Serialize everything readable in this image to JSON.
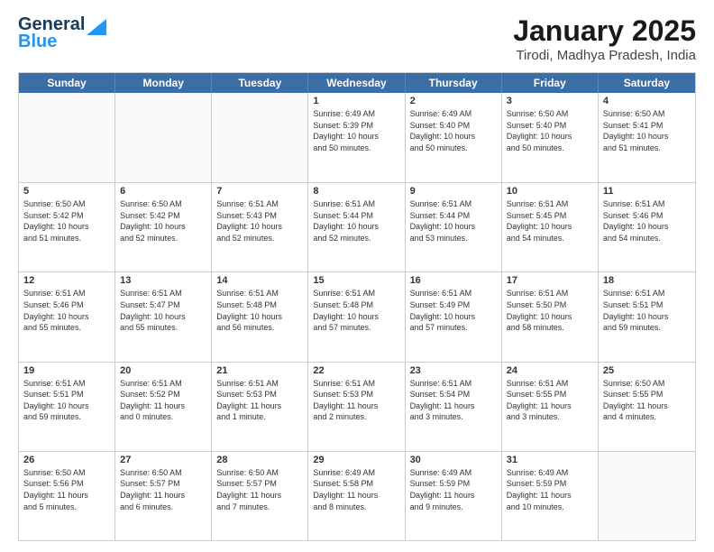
{
  "logo": {
    "line1": "General",
    "line2": "Blue"
  },
  "title": "January 2025",
  "subtitle": "Tirodi, Madhya Pradesh, India",
  "weekdays": [
    "Sunday",
    "Monday",
    "Tuesday",
    "Wednesday",
    "Thursday",
    "Friday",
    "Saturday"
  ],
  "weeks": [
    [
      {
        "day": "",
        "info": ""
      },
      {
        "day": "",
        "info": ""
      },
      {
        "day": "",
        "info": ""
      },
      {
        "day": "1",
        "info": "Sunrise: 6:49 AM\nSunset: 5:39 PM\nDaylight: 10 hours\nand 50 minutes."
      },
      {
        "day": "2",
        "info": "Sunrise: 6:49 AM\nSunset: 5:40 PM\nDaylight: 10 hours\nand 50 minutes."
      },
      {
        "day": "3",
        "info": "Sunrise: 6:50 AM\nSunset: 5:40 PM\nDaylight: 10 hours\nand 50 minutes."
      },
      {
        "day": "4",
        "info": "Sunrise: 6:50 AM\nSunset: 5:41 PM\nDaylight: 10 hours\nand 51 minutes."
      }
    ],
    [
      {
        "day": "5",
        "info": "Sunrise: 6:50 AM\nSunset: 5:42 PM\nDaylight: 10 hours\nand 51 minutes."
      },
      {
        "day": "6",
        "info": "Sunrise: 6:50 AM\nSunset: 5:42 PM\nDaylight: 10 hours\nand 52 minutes."
      },
      {
        "day": "7",
        "info": "Sunrise: 6:51 AM\nSunset: 5:43 PM\nDaylight: 10 hours\nand 52 minutes."
      },
      {
        "day": "8",
        "info": "Sunrise: 6:51 AM\nSunset: 5:44 PM\nDaylight: 10 hours\nand 52 minutes."
      },
      {
        "day": "9",
        "info": "Sunrise: 6:51 AM\nSunset: 5:44 PM\nDaylight: 10 hours\nand 53 minutes."
      },
      {
        "day": "10",
        "info": "Sunrise: 6:51 AM\nSunset: 5:45 PM\nDaylight: 10 hours\nand 54 minutes."
      },
      {
        "day": "11",
        "info": "Sunrise: 6:51 AM\nSunset: 5:46 PM\nDaylight: 10 hours\nand 54 minutes."
      }
    ],
    [
      {
        "day": "12",
        "info": "Sunrise: 6:51 AM\nSunset: 5:46 PM\nDaylight: 10 hours\nand 55 minutes."
      },
      {
        "day": "13",
        "info": "Sunrise: 6:51 AM\nSunset: 5:47 PM\nDaylight: 10 hours\nand 55 minutes."
      },
      {
        "day": "14",
        "info": "Sunrise: 6:51 AM\nSunset: 5:48 PM\nDaylight: 10 hours\nand 56 minutes."
      },
      {
        "day": "15",
        "info": "Sunrise: 6:51 AM\nSunset: 5:48 PM\nDaylight: 10 hours\nand 57 minutes."
      },
      {
        "day": "16",
        "info": "Sunrise: 6:51 AM\nSunset: 5:49 PM\nDaylight: 10 hours\nand 57 minutes."
      },
      {
        "day": "17",
        "info": "Sunrise: 6:51 AM\nSunset: 5:50 PM\nDaylight: 10 hours\nand 58 minutes."
      },
      {
        "day": "18",
        "info": "Sunrise: 6:51 AM\nSunset: 5:51 PM\nDaylight: 10 hours\nand 59 minutes."
      }
    ],
    [
      {
        "day": "19",
        "info": "Sunrise: 6:51 AM\nSunset: 5:51 PM\nDaylight: 10 hours\nand 59 minutes."
      },
      {
        "day": "20",
        "info": "Sunrise: 6:51 AM\nSunset: 5:52 PM\nDaylight: 11 hours\nand 0 minutes."
      },
      {
        "day": "21",
        "info": "Sunrise: 6:51 AM\nSunset: 5:53 PM\nDaylight: 11 hours\nand 1 minute."
      },
      {
        "day": "22",
        "info": "Sunrise: 6:51 AM\nSunset: 5:53 PM\nDaylight: 11 hours\nand 2 minutes."
      },
      {
        "day": "23",
        "info": "Sunrise: 6:51 AM\nSunset: 5:54 PM\nDaylight: 11 hours\nand 3 minutes."
      },
      {
        "day": "24",
        "info": "Sunrise: 6:51 AM\nSunset: 5:55 PM\nDaylight: 11 hours\nand 3 minutes."
      },
      {
        "day": "25",
        "info": "Sunrise: 6:50 AM\nSunset: 5:55 PM\nDaylight: 11 hours\nand 4 minutes."
      }
    ],
    [
      {
        "day": "26",
        "info": "Sunrise: 6:50 AM\nSunset: 5:56 PM\nDaylight: 11 hours\nand 5 minutes."
      },
      {
        "day": "27",
        "info": "Sunrise: 6:50 AM\nSunset: 5:57 PM\nDaylight: 11 hours\nand 6 minutes."
      },
      {
        "day": "28",
        "info": "Sunrise: 6:50 AM\nSunset: 5:57 PM\nDaylight: 11 hours\nand 7 minutes."
      },
      {
        "day": "29",
        "info": "Sunrise: 6:49 AM\nSunset: 5:58 PM\nDaylight: 11 hours\nand 8 minutes."
      },
      {
        "day": "30",
        "info": "Sunrise: 6:49 AM\nSunset: 5:59 PM\nDaylight: 11 hours\nand 9 minutes."
      },
      {
        "day": "31",
        "info": "Sunrise: 6:49 AM\nSunset: 5:59 PM\nDaylight: 11 hours\nand 10 minutes."
      },
      {
        "day": "",
        "info": ""
      }
    ]
  ]
}
